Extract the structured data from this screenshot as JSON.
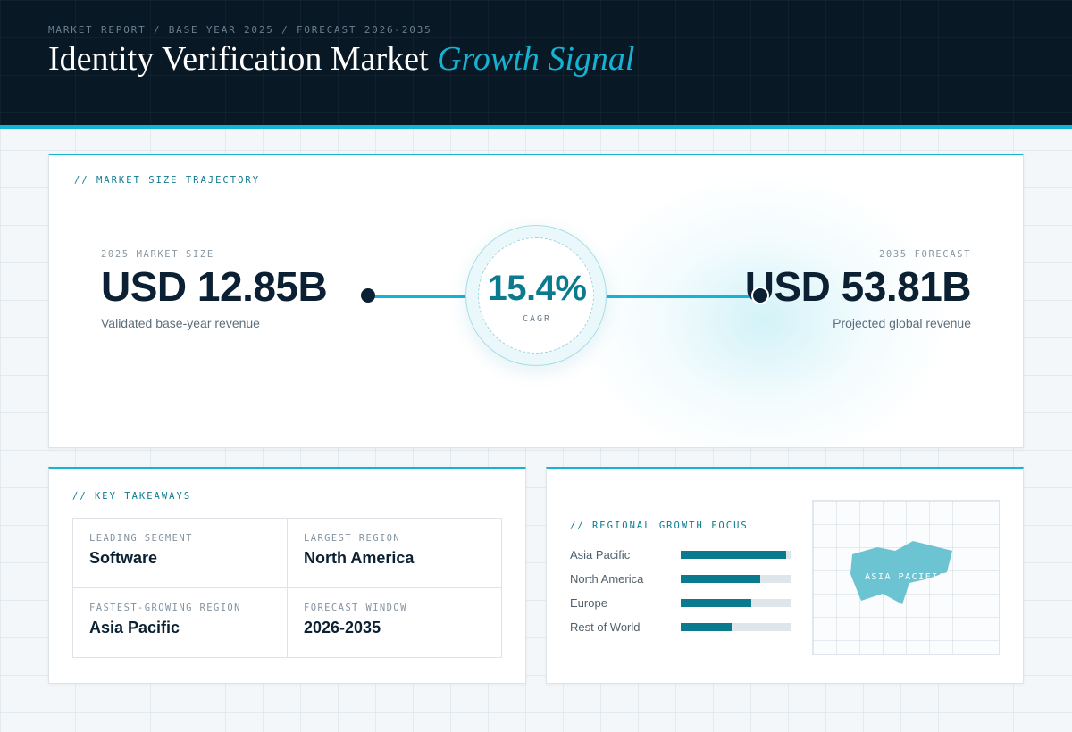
{
  "header": {
    "eyebrow": "MARKET REPORT / BASE YEAR 2025 / FORECAST 2026-2035",
    "title_main": "Identity Verification Market",
    "title_accent": "Growth Signal"
  },
  "trajectory": {
    "section_label": "// MARKET SIZE TRAJECTORY",
    "start": {
      "label": "2025 MARKET SIZE",
      "value": "USD 12.85B",
      "caption": "Validated base-year revenue"
    },
    "end": {
      "label": "2035 FORECAST",
      "value": "USD 53.81B",
      "caption": "Projected global revenue"
    },
    "cagr": {
      "value": "15.4%",
      "label": "CAGR"
    }
  },
  "takeaways": {
    "section_label": "// KEY TAKEAWAYS",
    "items": [
      {
        "label": "LEADING SEGMENT",
        "value": "Software"
      },
      {
        "label": "LARGEST REGION",
        "value": "North America"
      },
      {
        "label": "FASTEST-GROWING REGION",
        "value": "Asia Pacific"
      },
      {
        "label": "FORECAST WINDOW",
        "value": "2026-2035"
      }
    ]
  },
  "regional": {
    "section_label": "// REGIONAL GROWTH FOCUS",
    "bars": [
      {
        "name": "Asia Pacific",
        "level": 0.96
      },
      {
        "name": "North America",
        "level": 0.72
      },
      {
        "name": "Europe",
        "level": 0.64
      },
      {
        "name": "Rest of World",
        "level": 0.46
      }
    ],
    "map_label": "ASIA PACIFIC"
  },
  "colors": {
    "accent": "#14b4d4",
    "accent_dark": "#0a7b8e",
    "navy": "#081824",
    "map_region": "#6cc4d2"
  }
}
